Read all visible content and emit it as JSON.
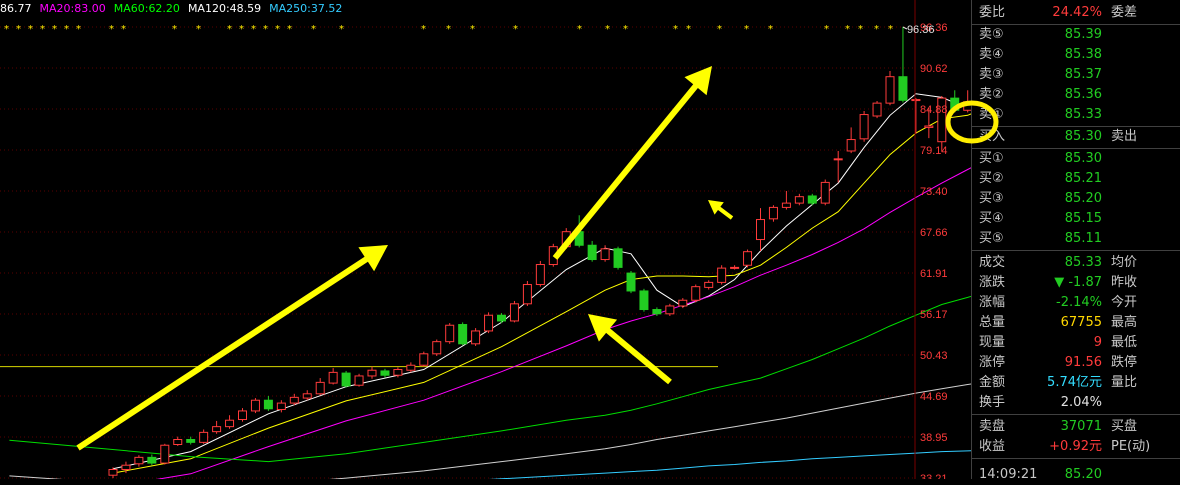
{
  "ma_legend": [
    {
      "label": "86.77",
      "color": "#ffffff"
    },
    {
      "label": "MA20:83.00",
      "color": "#ff00ff"
    },
    {
      "label": "MA60:62.20",
      "color": "#00ff00"
    },
    {
      "label": "MA120:48.59",
      "color": "#ffffff"
    },
    {
      "label": "MA250:37.52",
      "color": "#33ccff"
    }
  ],
  "chart_data": {
    "type": "candlestick",
    "y_ticks": [
      "96.36",
      "90.62",
      "84.88",
      "79.14",
      "73.40",
      "67.66",
      "61.91",
      "56.17",
      "50.43",
      "44.69",
      "38.95",
      "33.21"
    ],
    "ylim": [
      33.21,
      96.36
    ],
    "high_annotation": "96.36",
    "up_color": "#ff3b3b",
    "down_color": "#22cc22",
    "candles": [
      [
        33.6,
        34.4,
        33.2,
        34.7
      ],
      [
        34.4,
        35.0,
        33.9,
        35.5
      ],
      [
        35.2,
        36.1,
        34.8,
        36.4
      ],
      [
        36.1,
        35.3,
        35.0,
        36.5
      ],
      [
        35.3,
        37.8,
        35.1,
        38.0
      ],
      [
        37.9,
        38.6,
        37.7,
        39.0
      ],
      [
        38.6,
        38.2,
        37.9,
        39.0
      ],
      [
        38.2,
        39.6,
        38.0,
        40.0
      ],
      [
        39.7,
        40.4,
        39.4,
        41.2
      ],
      [
        40.4,
        41.3,
        40.1,
        42.0
      ],
      [
        41.4,
        42.6,
        41.1,
        43.0
      ],
      [
        42.6,
        44.1,
        42.3,
        44.4
      ],
      [
        44.1,
        42.9,
        42.6,
        44.7
      ],
      [
        42.8,
        43.7,
        42.4,
        44.1
      ],
      [
        43.7,
        44.5,
        43.4,
        45.0
      ],
      [
        44.4,
        45.0,
        44.1,
        45.5
      ],
      [
        45.0,
        46.6,
        44.8,
        47.2
      ],
      [
        46.5,
        48.0,
        46.3,
        48.6
      ],
      [
        47.9,
        46.1,
        45.9,
        48.2
      ],
      [
        46.2,
        47.5,
        46.0,
        47.8
      ],
      [
        47.5,
        48.3,
        47.1,
        48.8
      ],
      [
        48.2,
        47.6,
        47.3,
        48.5
      ],
      [
        47.6,
        48.4,
        47.3,
        48.7
      ],
      [
        48.3,
        49.0,
        48.0,
        49.4
      ],
      [
        49.0,
        50.6,
        48.8,
        50.9
      ],
      [
        50.6,
        52.3,
        50.3,
        52.6
      ],
      [
        52.3,
        54.6,
        52.0,
        54.9
      ],
      [
        54.7,
        52.0,
        51.8,
        55.0
      ],
      [
        52.0,
        53.8,
        51.7,
        54.2
      ],
      [
        53.8,
        56.0,
        53.5,
        56.4
      ],
      [
        56.0,
        55.2,
        54.9,
        56.3
      ],
      [
        55.2,
        57.6,
        55.0,
        58.0
      ],
      [
        57.6,
        60.3,
        57.3,
        60.8
      ],
      [
        60.3,
        63.1,
        60.0,
        63.6
      ],
      [
        63.1,
        65.6,
        62.8,
        66.0
      ],
      [
        65.6,
        67.7,
        65.3,
        68.2
      ],
      [
        67.7,
        65.8,
        65.5,
        70.0
      ],
      [
        65.8,
        63.8,
        63.5,
        66.4
      ],
      [
        63.8,
        65.3,
        63.5,
        65.8
      ],
      [
        65.3,
        62.7,
        62.4,
        65.6
      ],
      [
        61.9,
        59.4,
        59.1,
        62.2
      ],
      [
        59.4,
        56.8,
        56.5,
        59.7
      ],
      [
        56.8,
        56.2,
        55.9,
        57.1
      ],
      [
        56.2,
        57.3,
        55.9,
        57.6
      ],
      [
        57.3,
        58.1,
        57.0,
        58.4
      ],
      [
        58.1,
        60.0,
        57.8,
        60.3
      ],
      [
        59.9,
        60.6,
        59.6,
        60.9
      ],
      [
        60.6,
        62.6,
        60.3,
        63.0
      ],
      [
        62.6,
        62.7,
        62.4,
        63.0
      ],
      [
        63.0,
        64.9,
        62.7,
        65.2
      ],
      [
        66.6,
        69.4,
        65.0,
        71.0
      ],
      [
        69.5,
        71.1,
        69.1,
        71.4
      ],
      [
        71.1,
        71.7,
        70.8,
        73.4
      ],
      [
        71.7,
        72.6,
        71.4,
        73.0
      ],
      [
        72.7,
        71.7,
        71.4,
        73.0
      ],
      [
        71.7,
        74.6,
        71.4,
        75.0
      ],
      [
        77.8,
        77.9,
        74.6,
        79.0
      ],
      [
        79.0,
        80.6,
        78.7,
        82.3
      ],
      [
        80.7,
        84.1,
        80.3,
        84.6
      ],
      [
        83.9,
        85.7,
        83.6,
        86.0
      ],
      [
        85.7,
        89.4,
        85.4,
        90.2
      ],
      [
        89.4,
        86.1,
        85.8,
        96.4
      ],
      [
        86.1,
        86.2,
        81.4,
        86.4
      ],
      [
        82.3,
        82.5,
        80.8,
        85.0
      ],
      [
        80.3,
        86.4,
        78.9,
        86.7
      ],
      [
        86.4,
        84.7,
        84.4,
        87.5
      ],
      [
        84.7,
        85.9,
        84.4,
        87.5
      ],
      [
        86.0,
        89.4,
        84.3,
        90.7
      ],
      [
        89.4,
        88.8,
        88.5,
        90.5
      ],
      [
        88.8,
        89.0,
        86.2,
        91.0
      ],
      [
        89.2,
        84.8,
        84.5,
        94.3
      ],
      [
        84.7,
        87.6,
        84.4,
        89.3
      ],
      [
        86.2,
        88.9,
        86.9,
        92.8
      ],
      [
        88.9,
        87.4,
        86.9,
        89.5
      ],
      [
        86.2,
        84.5,
        83.6,
        86.7
      ],
      [
        85.9,
        85.3,
        83.9,
        86.4
      ]
    ],
    "ma_lines": [
      {
        "name": "MA5",
        "color": "#ffffff",
        "points": [
          [
            0,
            34.5
          ],
          [
            6,
            36.9
          ],
          [
            12,
            42.2
          ],
          [
            18,
            46.0
          ],
          [
            24,
            48.4
          ],
          [
            30,
            55.0
          ],
          [
            35,
            62.4
          ],
          [
            38,
            65.4
          ],
          [
            40,
            64.6
          ],
          [
            42,
            59.5
          ],
          [
            44,
            57.2
          ],
          [
            46,
            58.7
          ],
          [
            48,
            61.0
          ],
          [
            50,
            65.0
          ],
          [
            52,
            68.5
          ],
          [
            54,
            71.5
          ],
          [
            56,
            74.5
          ],
          [
            58,
            79.5
          ],
          [
            60,
            84.0
          ],
          [
            62,
            87.0
          ],
          [
            64,
            86.5
          ],
          [
            66,
            85.0
          ],
          [
            68,
            86.5
          ],
          [
            70,
            88.0
          ],
          [
            72,
            88.5
          ],
          [
            74,
            87.8
          ],
          [
            75,
            86.8
          ]
        ]
      },
      {
        "name": "MA10",
        "color": "#ffff00",
        "points": [
          [
            0,
            33.9
          ],
          [
            6,
            35.9
          ],
          [
            12,
            40.2
          ],
          [
            18,
            44.0
          ],
          [
            24,
            46.6
          ],
          [
            30,
            51.6
          ],
          [
            35,
            56.5
          ],
          [
            38,
            59.5
          ],
          [
            40,
            61.0
          ],
          [
            42,
            61.5
          ],
          [
            44,
            61.5
          ],
          [
            46,
            61.4
          ],
          [
            48,
            61.6
          ],
          [
            50,
            63.0
          ],
          [
            52,
            65.5
          ],
          [
            54,
            68.2
          ],
          [
            56,
            70.5
          ],
          [
            58,
            74.5
          ],
          [
            60,
            78.5
          ],
          [
            62,
            81.5
          ],
          [
            64,
            83.5
          ],
          [
            66,
            84.0
          ],
          [
            68,
            85.5
          ],
          [
            70,
            86.5
          ],
          [
            72,
            86.8
          ],
          [
            74,
            86.5
          ],
          [
            75,
            86.3
          ]
        ]
      },
      {
        "name": "MA20",
        "color": "#ff00ff",
        "points": [
          [
            0,
            32.0
          ],
          [
            6,
            33.8
          ],
          [
            12,
            37.6
          ],
          [
            18,
            41.2
          ],
          [
            24,
            44.1
          ],
          [
            30,
            48.1
          ],
          [
            35,
            51.7
          ],
          [
            38,
            54.0
          ],
          [
            40,
            55.2
          ],
          [
            42,
            56.2
          ],
          [
            44,
            57.4
          ],
          [
            46,
            58.6
          ],
          [
            48,
            60.0
          ],
          [
            50,
            61.6
          ],
          [
            52,
            63.0
          ],
          [
            54,
            64.5
          ],
          [
            56,
            66.2
          ],
          [
            58,
            68.1
          ],
          [
            60,
            70.4
          ],
          [
            62,
            72.5
          ],
          [
            64,
            74.5
          ],
          [
            66,
            76.4
          ],
          [
            68,
            78.3
          ],
          [
            70,
            79.8
          ],
          [
            72,
            81.1
          ],
          [
            74,
            82.2
          ],
          [
            75,
            83.0
          ]
        ]
      },
      {
        "name": "MA60",
        "color": "#00dd00",
        "points": [
          [
            -8,
            38.5
          ],
          [
            6,
            36.2
          ],
          [
            12,
            35.5
          ],
          [
            18,
            36.6
          ],
          [
            24,
            38.2
          ],
          [
            30,
            39.8
          ],
          [
            35,
            41.3
          ],
          [
            38,
            42.0
          ],
          [
            40,
            42.7
          ],
          [
            42,
            43.6
          ],
          [
            44,
            44.6
          ],
          [
            46,
            45.6
          ],
          [
            48,
            46.4
          ],
          [
            50,
            47.2
          ],
          [
            52,
            48.5
          ],
          [
            54,
            49.8
          ],
          [
            56,
            51.3
          ],
          [
            58,
            52.8
          ],
          [
            60,
            54.5
          ],
          [
            62,
            56.0
          ],
          [
            64,
            57.5
          ],
          [
            66,
            58.5
          ],
          [
            68,
            59.6
          ],
          [
            70,
            60.5
          ],
          [
            72,
            61.2
          ],
          [
            74,
            61.9
          ],
          [
            75,
            62.2
          ]
        ]
      },
      {
        "name": "MA120",
        "color": "#d0d0d0",
        "points": [
          [
            -8,
            33.5
          ],
          [
            6,
            31.8
          ],
          [
            12,
            32.3
          ],
          [
            18,
            33.2
          ],
          [
            24,
            34.2
          ],
          [
            30,
            35.5
          ],
          [
            35,
            36.6
          ],
          [
            38,
            37.3
          ],
          [
            40,
            37.9
          ],
          [
            42,
            38.6
          ],
          [
            44,
            39.2
          ],
          [
            46,
            39.8
          ],
          [
            48,
            40.4
          ],
          [
            50,
            41.0
          ],
          [
            52,
            41.6
          ],
          [
            54,
            42.3
          ],
          [
            56,
            43.0
          ],
          [
            58,
            43.7
          ],
          [
            60,
            44.4
          ],
          [
            62,
            45.1
          ],
          [
            64,
            45.7
          ],
          [
            66,
            46.3
          ],
          [
            68,
            46.9
          ],
          [
            70,
            47.5
          ],
          [
            72,
            47.9
          ],
          [
            74,
            48.3
          ],
          [
            75,
            48.6
          ]
        ]
      },
      {
        "name": "MA250",
        "color": "#33ccff",
        "points": [
          [
            -8,
            29.5
          ],
          [
            6,
            30.6
          ],
          [
            12,
            31.3
          ],
          [
            18,
            31.9
          ],
          [
            24,
            32.5
          ],
          [
            30,
            33.1
          ],
          [
            35,
            33.6
          ],
          [
            38,
            33.9
          ],
          [
            40,
            34.1
          ],
          [
            42,
            34.3
          ],
          [
            44,
            34.6
          ],
          [
            46,
            34.9
          ],
          [
            48,
            35.1
          ],
          [
            50,
            35.4
          ],
          [
            52,
            35.6
          ],
          [
            54,
            35.9
          ],
          [
            56,
            36.1
          ],
          [
            58,
            36.3
          ],
          [
            60,
            36.5
          ],
          [
            62,
            36.7
          ],
          [
            64,
            36.9
          ],
          [
            66,
            37.0
          ],
          [
            68,
            37.1
          ],
          [
            70,
            37.3
          ],
          [
            72,
            37.4
          ],
          [
            74,
            37.5
          ],
          [
            75,
            37.5
          ]
        ]
      }
    ],
    "hline": 48.8
  },
  "panel": {
    "webi": {
      "label": "委比",
      "value": "24.42%",
      "extra": "委差"
    },
    "sells": [
      {
        "label": "卖⑤",
        "price": "85.39"
      },
      {
        "label": "卖④",
        "price": "85.38"
      },
      {
        "label": "卖③",
        "price": "85.37"
      },
      {
        "label": "卖②",
        "price": "85.36"
      },
      {
        "label": "卖①",
        "price": "85.33"
      }
    ],
    "buyin": {
      "label": "买入",
      "price": "85.30",
      "extra": "卖出"
    },
    "buys": [
      {
        "label": "买①",
        "price": "85.30"
      },
      {
        "label": "买②",
        "price": "85.21"
      },
      {
        "label": "买③",
        "price": "85.20"
      },
      {
        "label": "买④",
        "price": "85.15"
      },
      {
        "label": "买⑤",
        "price": "85.11"
      }
    ],
    "stats": [
      {
        "label": "成交",
        "value": "85.33",
        "label2": "均价",
        "color": "green"
      },
      {
        "label": "涨跌",
        "value": "▼ -1.87",
        "label2": "昨收",
        "color": "green"
      },
      {
        "label": "涨幅",
        "value": "-2.14%",
        "label2": "今开",
        "color": "green"
      },
      {
        "label": "总量",
        "value": "67755",
        "label2": "最高",
        "color": "yellow"
      },
      {
        "label": "现量",
        "value": "9",
        "label2": "最低",
        "color": "red"
      },
      {
        "label": "涨停",
        "value": "91.56",
        "label2": "跌停",
        "color": "red"
      },
      {
        "label": "金额",
        "value": "5.74亿元",
        "label2": "量比",
        "color": "cyan"
      },
      {
        "label": "换手",
        "value": "2.04%",
        "label2": "",
        "color": "white"
      }
    ],
    "stats2": [
      {
        "label": "卖盘",
        "value": "37071",
        "label2": "买盘",
        "color": "green"
      },
      {
        "label": "收益",
        "value": "+0.92元",
        "label2": "PE(动)",
        "color": "red"
      }
    ],
    "tick": {
      "time": "14:09:21",
      "price": "85.20"
    }
  }
}
